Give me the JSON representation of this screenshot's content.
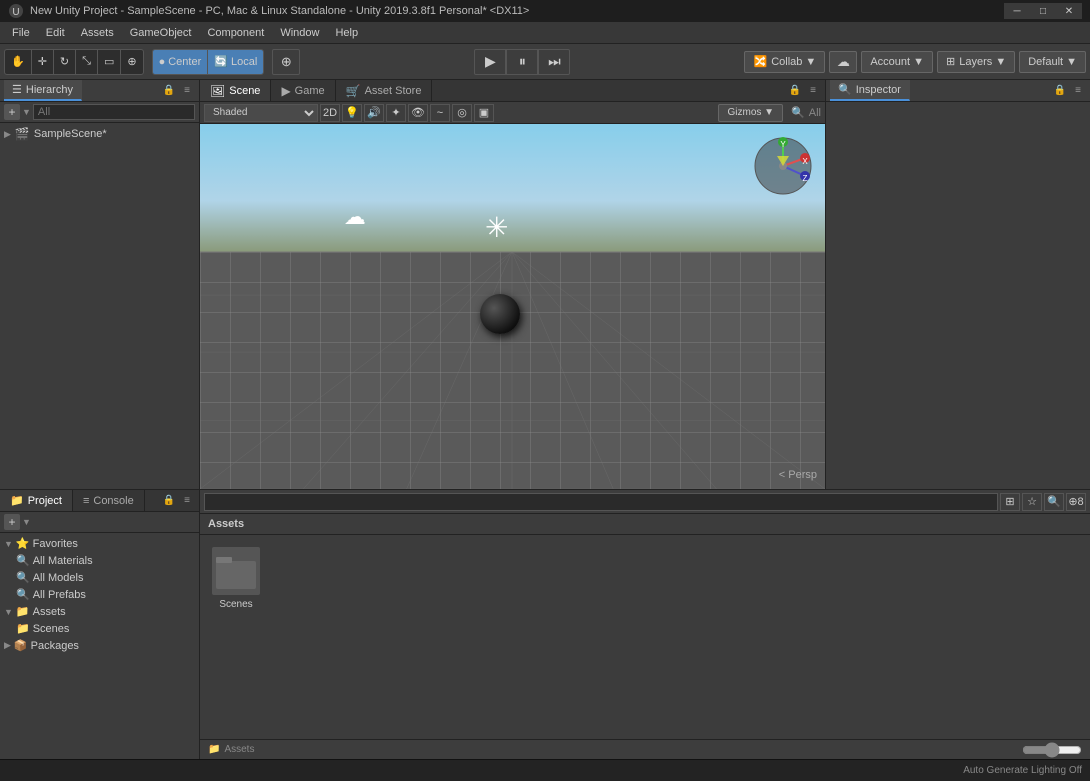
{
  "window": {
    "title": "New Unity Project - SampleScene - PC, Mac & Linux Standalone - Unity 2019.3.8f1 Personal* <DX11>",
    "app_name": "New Unity"
  },
  "menu": {
    "items": [
      "File",
      "Edit",
      "Assets",
      "GameObject",
      "Component",
      "Window",
      "Help"
    ]
  },
  "toolbar": {
    "transform_tools": [
      "hand",
      "move",
      "rotate",
      "scale",
      "rect",
      "custom"
    ],
    "pivot_center": "Center",
    "pivot_local": "Local",
    "transform_extra": "⊕",
    "play": "▶",
    "pause": "⏸",
    "step": "⏭",
    "collab": "Collab ▼",
    "cloud": "☁",
    "account": "Account ▼",
    "layers": "Layers ▼",
    "layout": "Default ▼"
  },
  "hierarchy": {
    "title": "Hierarchy",
    "search_placeholder": "All",
    "scene_name": "SampleScene*"
  },
  "scene": {
    "title": "Scene",
    "game_title": "Game",
    "asset_store_title": "Asset Store",
    "shading_mode": "Shaded",
    "view_mode": "2D",
    "gizmos": "Gizmos ▼",
    "all_label": "All",
    "persp": "< Persp"
  },
  "inspector": {
    "title": "Inspector"
  },
  "project": {
    "title": "Project",
    "console_title": "Console",
    "favorites": "Favorites",
    "all_materials": "All Materials",
    "all_models": "All Models",
    "all_prefabs": "All Prefabs",
    "assets_label": "Assets",
    "scenes_label": "Scenes",
    "packages_label": "Packages"
  },
  "assets": {
    "title": "Assets",
    "search_placeholder": "",
    "folders": [
      {
        "name": "Scenes",
        "icon": "📁"
      }
    ],
    "footer_path": "Assets",
    "auto_generate": "Auto Generate Lighting Off"
  },
  "colors": {
    "accent": "#4a90d9",
    "bg_dark": "#1e1e1e",
    "bg_panel": "#3c3c3c",
    "bg_toolbar": "#3d3d3d",
    "text_light": "#ccc",
    "border": "#222"
  }
}
